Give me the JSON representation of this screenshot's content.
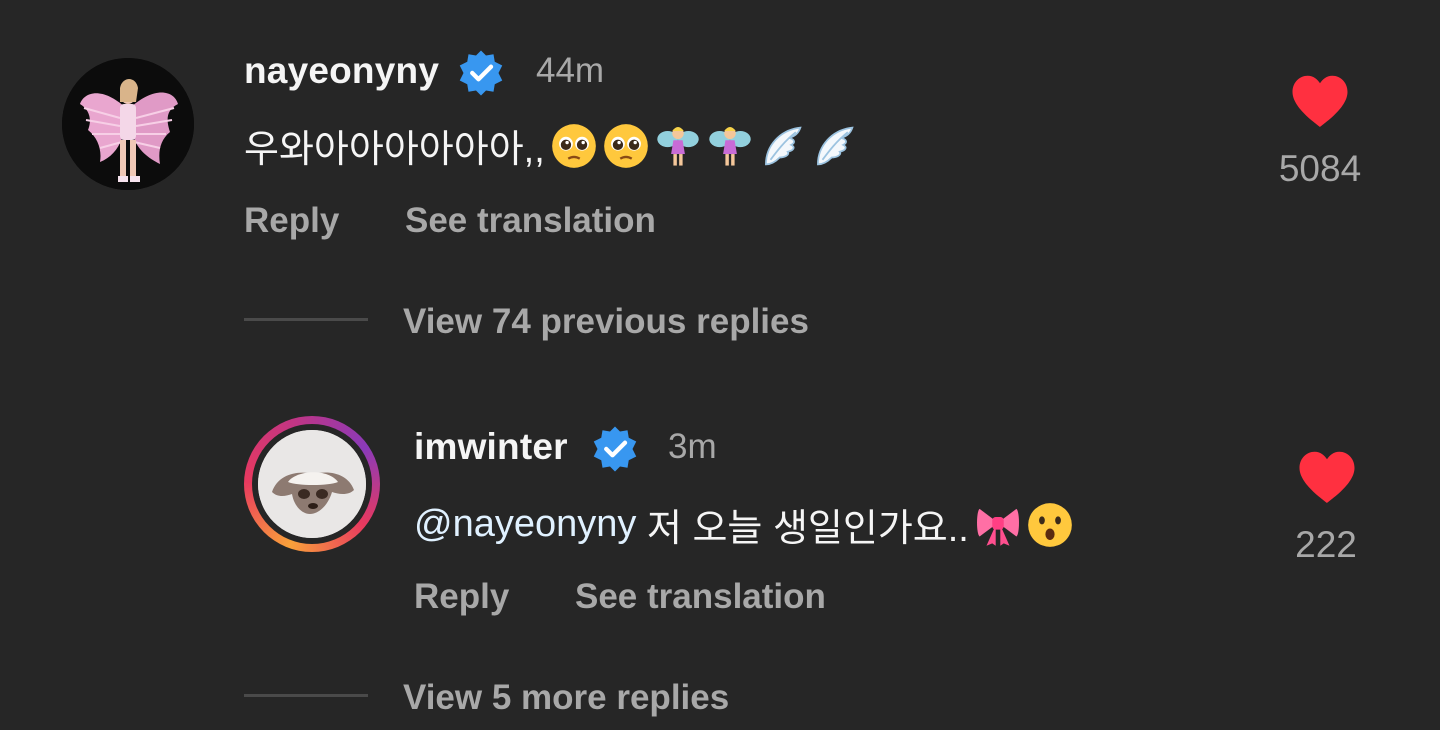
{
  "comment": {
    "username": "nayeonyny",
    "time": "44m",
    "text": "우와아아아아아아,,",
    "emojis": [
      "pleading-face",
      "pleading-face",
      "fairy",
      "fairy",
      "wing",
      "wing"
    ],
    "reply_label": "Reply",
    "translate_label": "See translation",
    "likes": "5084"
  },
  "view_previous": "View 74 previous replies",
  "reply": {
    "username": "imwinter",
    "time": "3m",
    "mention": "@nayeonyny",
    "text": " 저 오늘 생일인가요..",
    "emojis": [
      "ribbon",
      "hushed-face"
    ],
    "reply_label": "Reply",
    "translate_label": "See translation",
    "likes": "222"
  },
  "view_more": "View 5 more replies",
  "colors": {
    "background": "#262626",
    "heart": "#ff3040",
    "verified": "#3897f0",
    "muted": "#a8a8a8"
  }
}
